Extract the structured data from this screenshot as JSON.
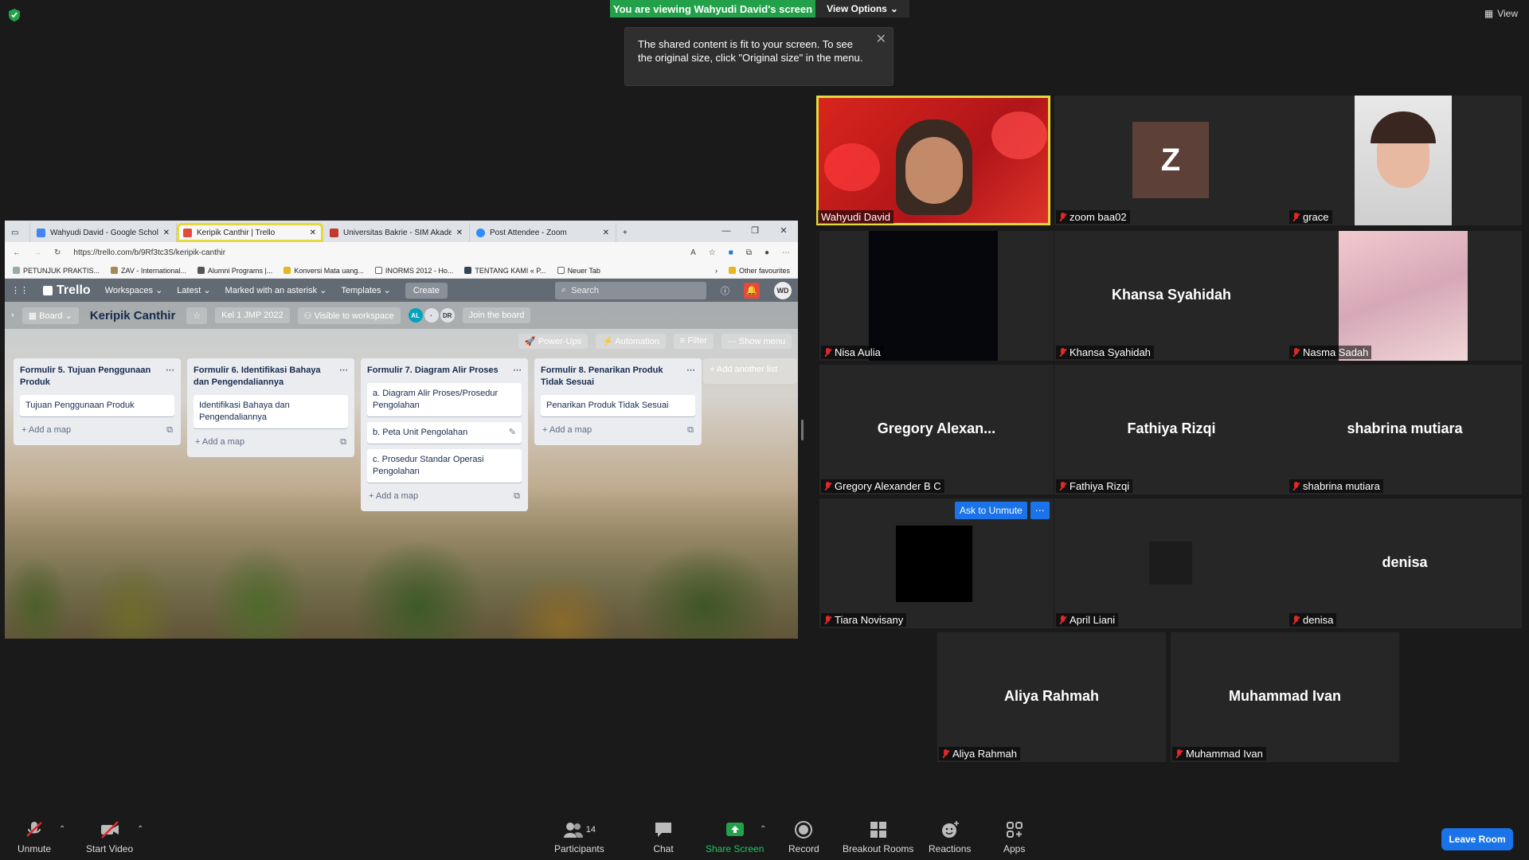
{
  "top": {
    "banner": "You are viewing Wahyudi David's screen",
    "view_options": "View Options",
    "view": "View",
    "tooltip": "The shared content is fit to your screen. To see the original size, click \"Original size\" in the menu."
  },
  "browser": {
    "tabs": [
      {
        "label": "Wahyudi David - Google Scholar"
      },
      {
        "label": "Keripik Canthir | Trello"
      },
      {
        "label": "Universitas Bakrie - SIM Akadem"
      },
      {
        "label": "Post Attendee - Zoom"
      }
    ],
    "url": "https://trello.com/b/9Rf3tc3S/keripik-canthir",
    "bookmarks": [
      "PETUNJUK PRAKTIS...",
      "ZAV - International...",
      "Alumni Programs |...",
      "Konversi Mata uang...",
      "INORMS 2012 - Ho...",
      "TENTANG KAMI « P...",
      "Neuer Tab",
      "Other favourites"
    ]
  },
  "trello": {
    "logo": "Trello",
    "nav": [
      "Workspaces",
      "Latest",
      "Marked with an asterisk",
      "Templates"
    ],
    "create": "Create",
    "search": "Search",
    "avatar": "WD",
    "board_view": "Board",
    "board_title": "Keripik Canthir",
    "team": "Kel 1 JMP 2022",
    "visibility": "Visible to workspace",
    "member_avatars": [
      "AL",
      "DR"
    ],
    "join": "Join the board",
    "power_ups": "Power-Ups",
    "automation": "Automation",
    "filter": "Filter",
    "show_menu": "Show menu",
    "add_list": "+ Add another list",
    "lists": [
      {
        "title": "Formulir 5. Tujuan Penggunaan Produk",
        "cards": [
          "Tujuan Penggunaan Produk"
        ],
        "add": "+ Add a map"
      },
      {
        "title": "Formulir 6. Identifikasi Bahaya dan Pengendaliannya",
        "cards": [
          "Identifikasi Bahaya dan Pengendaliannya"
        ],
        "add": "+ Add a map"
      },
      {
        "title": "Formulir 7. Diagram Alir Proses",
        "cards": [
          "a. Diagram Alir Proses/Prosedur Pengolahan",
          "b. Peta Unit Pengolahan",
          "c. Prosedur Standar Operasi Pengolahan"
        ],
        "add": "+ Add a map"
      },
      {
        "title": "Formulir 8. Penarikan Produk Tidak Sesuai",
        "cards": [
          "Penarikan Produk Tidak Sesuai"
        ],
        "add": "+ Add a map"
      }
    ]
  },
  "participants": [
    {
      "name": "Wahyudi David"
    },
    {
      "name": "zoom baa02",
      "initial": "Z"
    },
    {
      "name": "grace"
    },
    {
      "name": "Nisa Aulia"
    },
    {
      "name": "Khansa Syahidah",
      "big": "Khansa Syahidah"
    },
    {
      "name": "Nasma Sadah"
    },
    {
      "name": "Gregory Alexander B C",
      "big": "Gregory  Alexan..."
    },
    {
      "name": "Fathiya Rizqi",
      "big": "Fathiya Rizqi"
    },
    {
      "name": "shabrina mutiara",
      "big": "shabrina mutiara"
    },
    {
      "name": "Tiara Novisany"
    },
    {
      "name": "April Liani"
    },
    {
      "name": "denisa",
      "big": "denisa"
    },
    {
      "name": "Aliya Rahmah",
      "big": "Aliya Rahmah"
    },
    {
      "name": "Muhammad Ivan",
      "big": "Muhammad Ivan"
    }
  ],
  "ask_to_unmute": "Ask to Unmute",
  "toolbar": {
    "unmute": "Unmute",
    "start_video": "Start Video",
    "participants": "Participants",
    "participants_count": "14",
    "chat": "Chat",
    "share_screen": "Share Screen",
    "record": "Record",
    "breakout": "Breakout Rooms",
    "reactions": "Reactions",
    "apps": "Apps",
    "leave": "Leave Room"
  },
  "colors": {
    "share_green": "#22a14a",
    "active_speaker": "#e4d93e",
    "leave_blue": "#1a73e8",
    "muted_red": "#e02828"
  }
}
